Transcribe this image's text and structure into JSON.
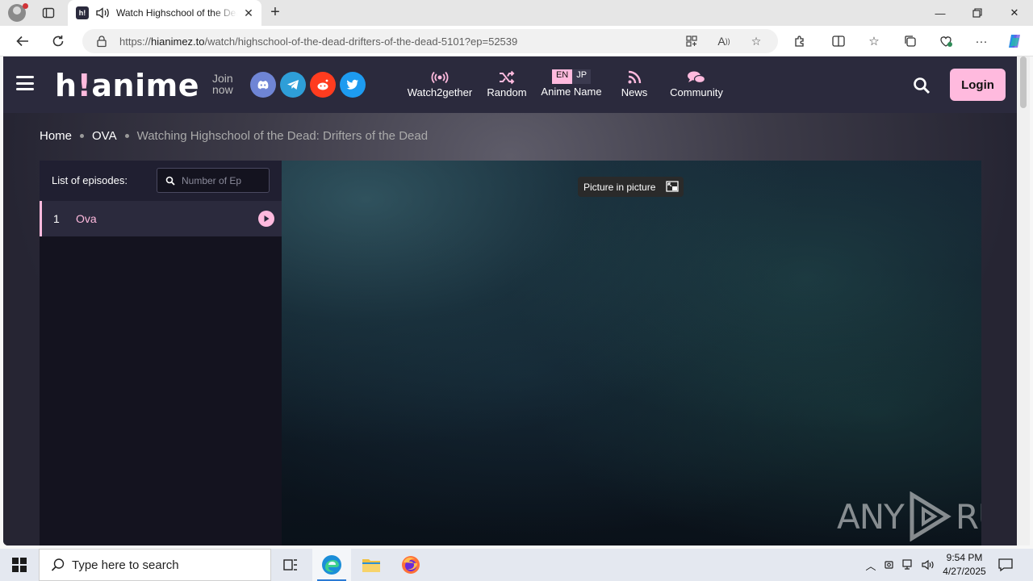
{
  "browser": {
    "tab_title": "Watch Highschool of the Dead: Drifters of the Dead",
    "tab_favicon_text": "h!",
    "url_prefix": "https://",
    "url_domain": "hianimez.to",
    "url_path": "/watch/highschool-of-the-dead-drifters-of-the-dead-5101?ep=52539",
    "icons": [
      "profile-icon",
      "tab-actions-icon",
      "speaker-icon",
      "close-icon",
      "new-tab-icon",
      "minimize-icon",
      "restore-icon",
      "close-window-icon",
      "back-icon",
      "refresh-icon",
      "lock-icon",
      "app-available-icon",
      "read-aloud-icon",
      "favorite-icon",
      "extensions-icon",
      "split-screen-icon",
      "favorites-icon",
      "collections-icon",
      "browser-essentials-icon",
      "more-icon",
      "copilot-icon"
    ]
  },
  "site": {
    "logo_h": "h",
    "logo_bang": "!",
    "logo_rest": "anime",
    "join_line1": "Join",
    "join_line2": "now",
    "social": [
      {
        "name": "discord",
        "color": "#6f85d5"
      },
      {
        "name": "telegram",
        "color": "#2e9ed8"
      },
      {
        "name": "reddit",
        "color": "#ff3c1f"
      },
      {
        "name": "twitter",
        "color": "#1d9bf0"
      }
    ],
    "nav": {
      "watch2gether": "Watch2gether",
      "random": "Random",
      "anime_name": "Anime Name",
      "lang_en": "EN",
      "lang_jp": "JP",
      "news": "News",
      "community": "Community"
    },
    "login": "Login",
    "accent_color": "#ffbade"
  },
  "breadcrumb": {
    "home": "Home",
    "category": "OVA",
    "current": "Watching Highschool of the Dead: Drifters of the Dead"
  },
  "episodes": {
    "title": "List of episodes:",
    "search_placeholder": "Number of Ep",
    "items": [
      {
        "number": "1",
        "name": "Ova"
      }
    ]
  },
  "player": {
    "pip_label": "Picture in picture",
    "watermark_left": "ANY",
    "watermark_right": "RUN"
  },
  "taskbar": {
    "search_placeholder": "Type here to search",
    "time": "9:54 PM",
    "date": "4/27/2025"
  }
}
